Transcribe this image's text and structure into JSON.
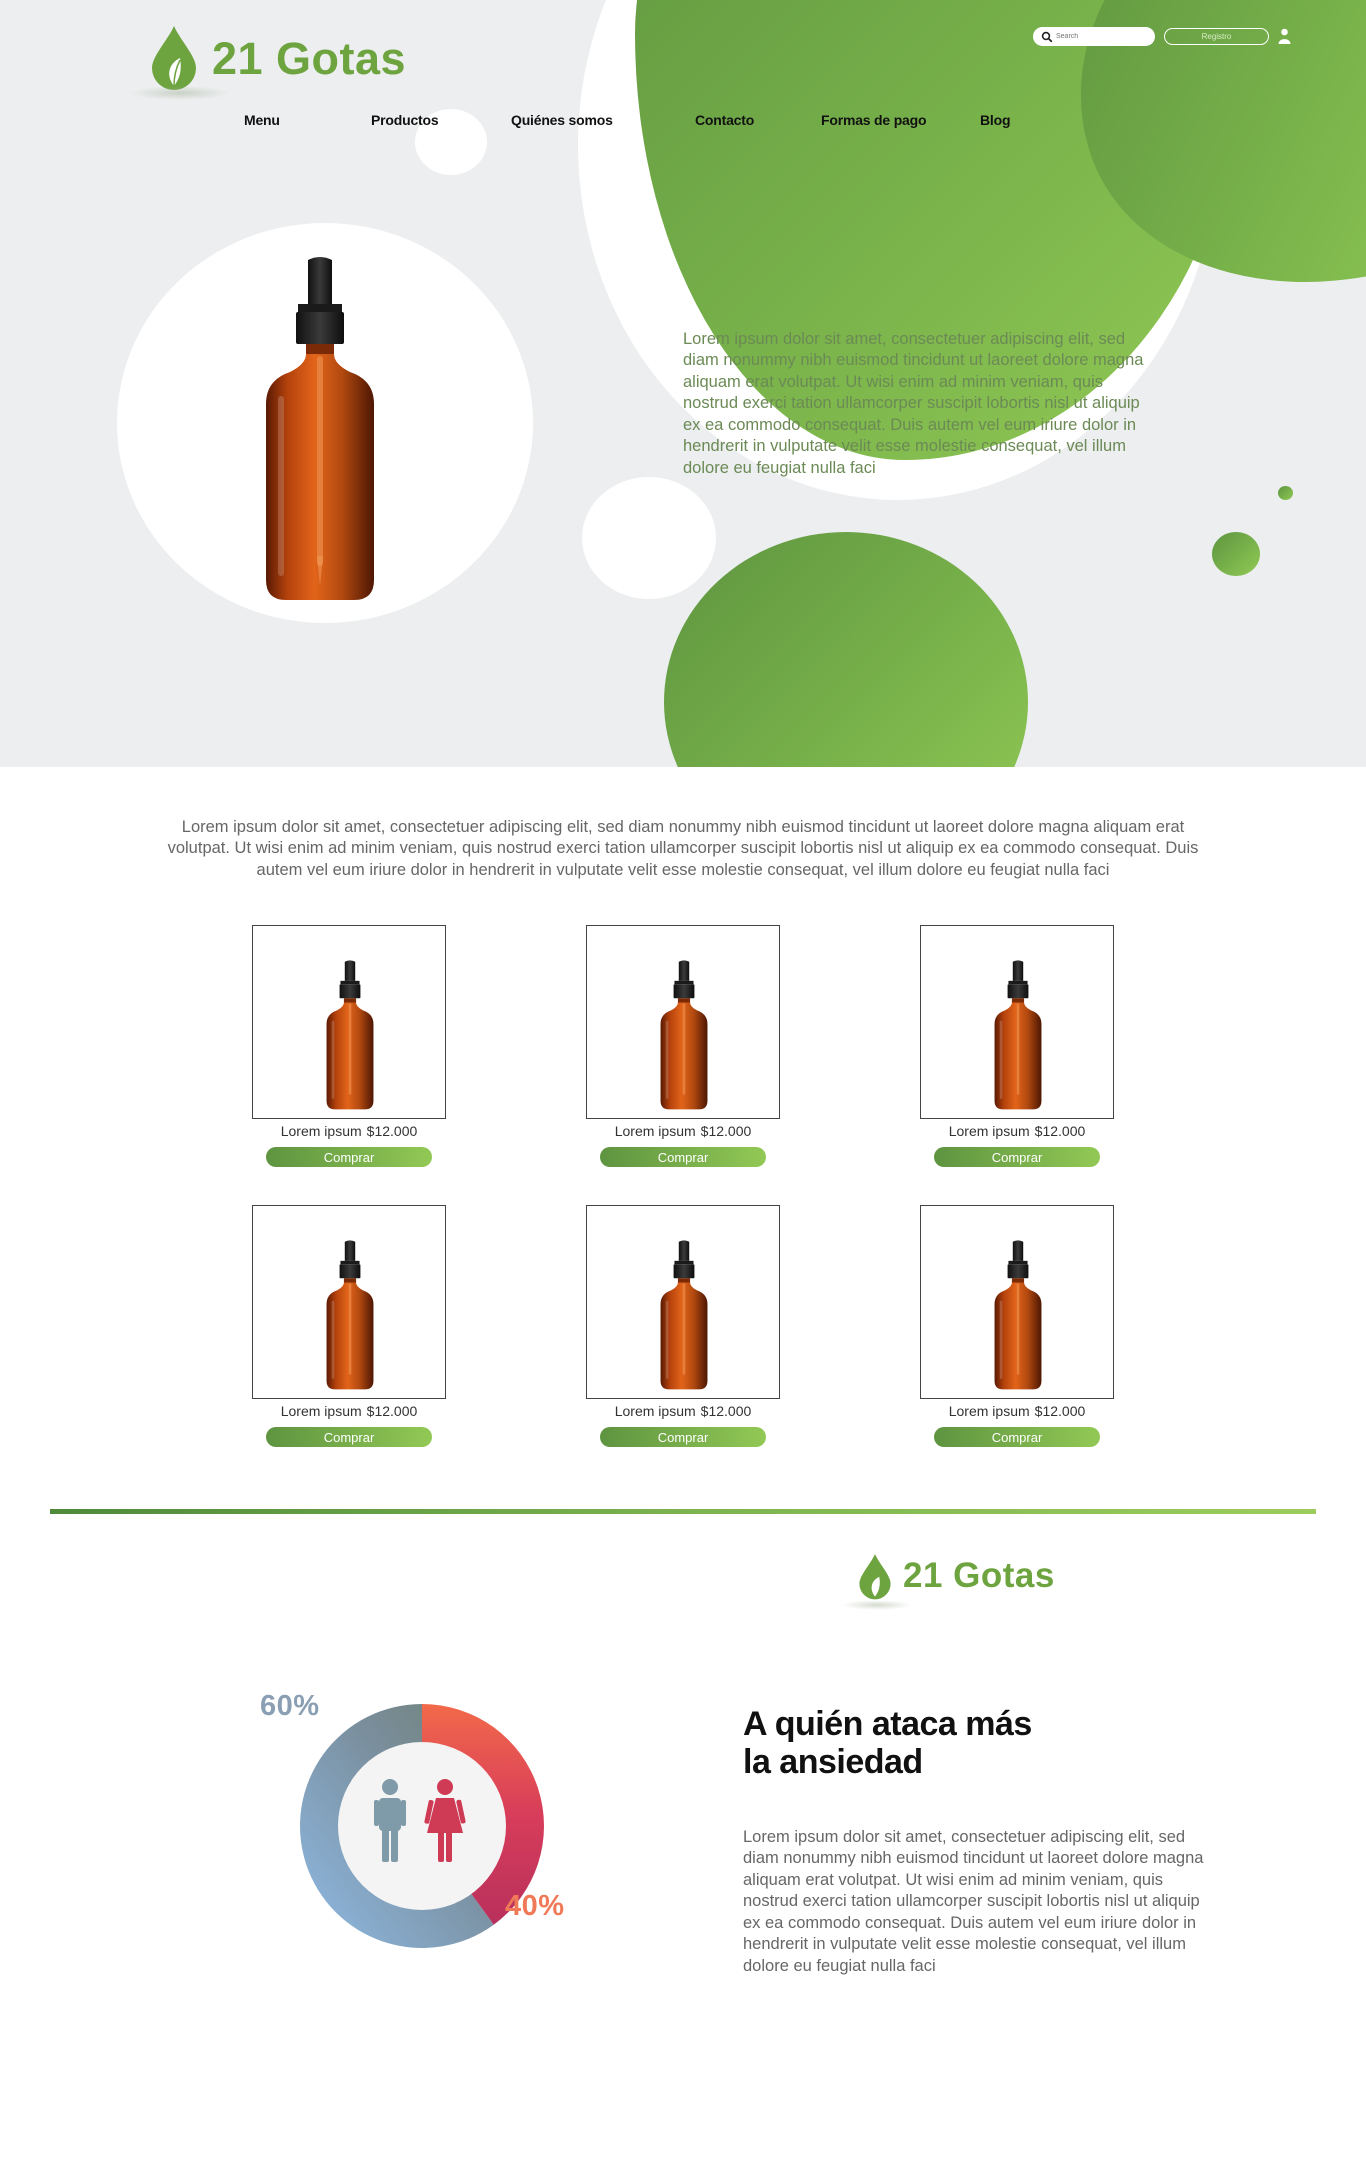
{
  "brand": {
    "name": "21 Gotas",
    "color": "#6da43f"
  },
  "header": {
    "search_placeholder": "Search",
    "register_label": "Registro",
    "icons": {
      "search": "search-icon",
      "user": "user-icon"
    }
  },
  "nav": {
    "items": [
      {
        "label": "Menu"
      },
      {
        "label": "Productos"
      },
      {
        "label": "Quiénes somos"
      },
      {
        "label": "Contacto"
      },
      {
        "label": "Formas de pago"
      },
      {
        "label": "Blog"
      }
    ]
  },
  "hero": {
    "text": "Lorem ipsum dolor sit amet, consectetuer adipiscing elit, sed diam nonummy nibh euismod tincidunt ut laoreet dolore magna aliquam erat volutpat. Ut wisi enim ad minim veniam, quis nostrud exerci tation ullamcorper suscipit lobortis nisl ut aliquip ex ea commodo consequat. Duis autem vel eum iriure dolor in hendrerit in vulputate velit esse molestie consequat, vel illum dolore eu feugiat nulla faci"
  },
  "intro": {
    "text": "Lorem ipsum dolor sit amet, consectetuer adipiscing elit, sed diam nonummy nibh euismod tincidunt ut laoreet dolore magna aliquam erat volutpat. Ut wisi enim ad minim veniam, quis nostrud exerci tation ullamcorper suscipit lobortis nisl ut aliquip ex ea commodo consequat. Duis autem vel eum iriure dolor in hendrerit in vulputate velit esse molestie consequat, vel illum dolore eu feugiat nulla faci"
  },
  "products": [
    {
      "name": "Lorem ipsum",
      "price": "$12.000",
      "cta": "Comprar"
    },
    {
      "name": "Lorem ipsum",
      "price": "$12.000",
      "cta": "Comprar"
    },
    {
      "name": "Lorem ipsum",
      "price": "$12.000",
      "cta": "Comprar"
    },
    {
      "name": "Lorem ipsum",
      "price": "$12.000",
      "cta": "Comprar"
    },
    {
      "name": "Lorem ipsum",
      "price": "$12.000",
      "cta": "Comprar"
    },
    {
      "name": "Lorem ipsum",
      "price": "$12.000",
      "cta": "Comprar"
    }
  ],
  "anxiety": {
    "title_line1": "A quién ataca más",
    "title_line2": "la ansiedad",
    "text": "Lorem ipsum dolor sit amet, consectetuer adipiscing elit, sed diam nonummy nibh euismod tincidunt ut laoreet dolore magna aliquam erat volutpat. Ut wisi enim ad minim veniam, quis nostrud exerci tation ullamcorper suscipit lobortis nisl ut aliquip ex ea commodo consequat. Duis autem vel eum iriure dolor in hendrerit in vulputate velit esse molestie consequat, vel illum dolore eu feugiat nulla faci"
  },
  "chart_data": {
    "type": "pie",
    "categories": [
      "Hombres",
      "Mujeres"
    ],
    "values": [
      60,
      40
    ],
    "labels": [
      "60%",
      "40%"
    ],
    "colors": {
      "male_label": "#8a9fb3",
      "female_label": "#f07a58"
    }
  },
  "colors": {
    "green_dark": "#5e9440",
    "green_light": "#92c955",
    "hero_bg": "#eceeef"
  }
}
